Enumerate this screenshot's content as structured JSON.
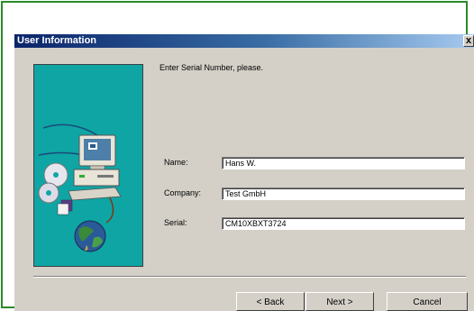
{
  "dialog": {
    "title": "User Information",
    "close_label": "x"
  },
  "prompt": "Enter Serial Number, please.",
  "form": {
    "name": {
      "label": "Name:",
      "value": "Hans W."
    },
    "company": {
      "label": "Company:",
      "value": "Test GmbH"
    },
    "serial": {
      "label": "Serial:",
      "value": "CM10XBXT3724"
    }
  },
  "buttons": {
    "back": "< Back",
    "next": "Next >",
    "cancel": "Cancel"
  },
  "colors": {
    "titlebar_start": "#0a246a",
    "titlebar_end": "#a6caf0",
    "dialog_face": "#d4d0c8",
    "art_background": "#0fa5a5",
    "outer_frame": "#2a8a2a"
  }
}
